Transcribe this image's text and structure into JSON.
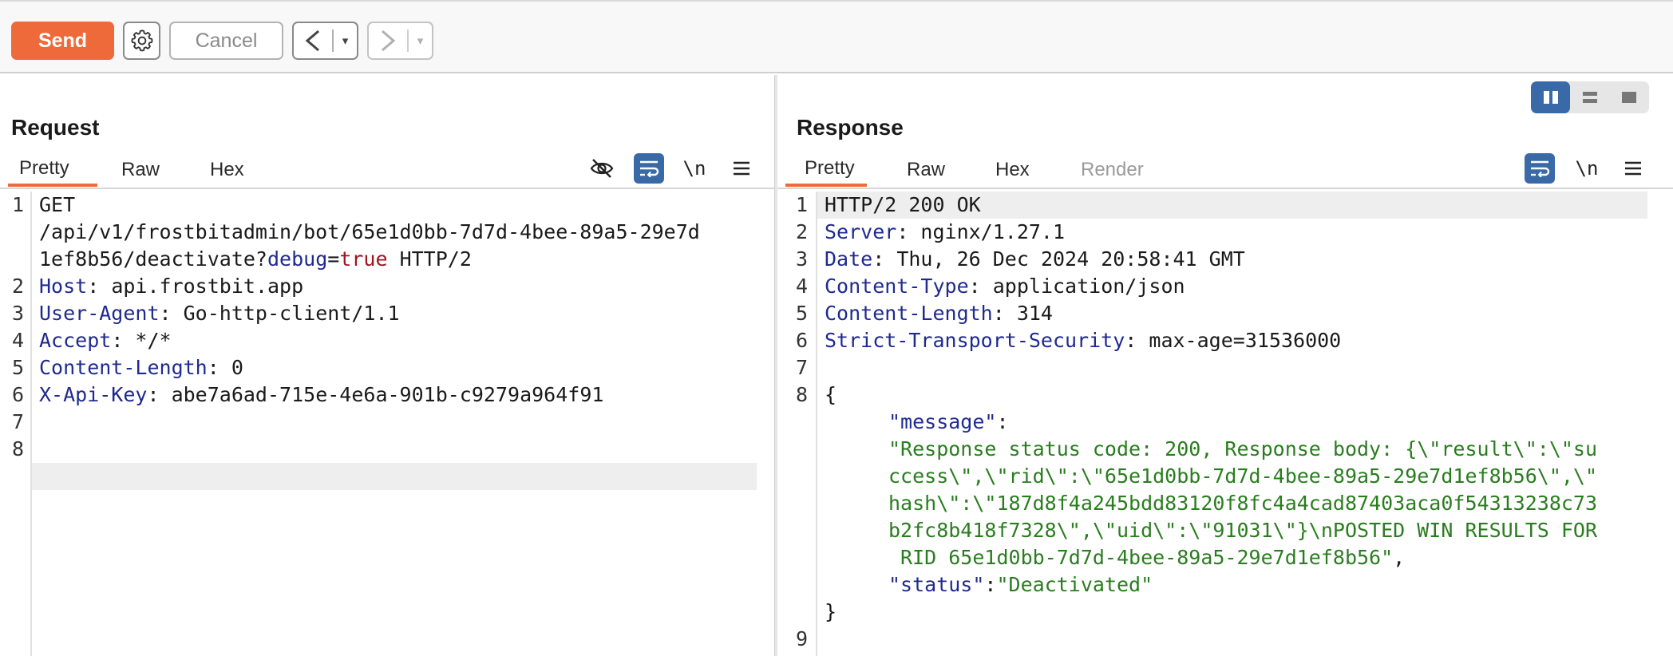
{
  "toolbar": {
    "send_label": "Send",
    "cancel_label": "Cancel",
    "back_glyph": "<",
    "forward_glyph": ">",
    "dropdown_glyph": "▾"
  },
  "request": {
    "title": "Request",
    "tabs": [
      "Pretty",
      "Raw",
      "Hex"
    ],
    "active_tab": "Pretty",
    "newline_toggle": "\\n",
    "line_numbers": [
      "1",
      "2",
      "3",
      "4",
      "5",
      "6",
      "7",
      "8"
    ],
    "line1": {
      "method": "GET",
      "path_a": "/api/v1/frostbitadmin/bot/65e1d0bb-7d7d-4bee-89a5-29e7d",
      "path_b": "1ef8b56/deactivate?",
      "param_key": "debug",
      "equals": "=",
      "param_value": "true",
      "protocol": " HTTP/2"
    },
    "headers": [
      {
        "name": "Host",
        "value": "api.frostbit.app"
      },
      {
        "name": "User-Agent",
        "value": "Go-http-client/1.1"
      },
      {
        "name": "Accept",
        "value": "*/*"
      },
      {
        "name": "Content-Length",
        "value": "0"
      },
      {
        "name": "X-Api-Key",
        "value": "abe7a6ad-715e-4e6a-901b-c9279a964f91"
      }
    ]
  },
  "response": {
    "title": "Response",
    "tabs": [
      "Pretty",
      "Raw",
      "Hex",
      "Render"
    ],
    "active_tab": "Pretty",
    "newline_toggle": "\\n",
    "line_numbers": [
      "1",
      "2",
      "3",
      "4",
      "5",
      "6",
      "7",
      "8",
      "9"
    ],
    "status_line": "HTTP/2 200 OK",
    "headers": [
      {
        "name": "Server",
        "value": "nginx/1.27.1"
      },
      {
        "name": "Date",
        "value": "Thu, 26 Dec 2024 20:58:41 GMT"
      },
      {
        "name": "Content-Type",
        "value": "application/json"
      },
      {
        "name": "Content-Length",
        "value": "314"
      },
      {
        "name": "Strict-Transport-Security",
        "value": "max-age=31536000"
      }
    ],
    "body": {
      "open_brace": "{",
      "message_key": "\"message\"",
      "colon": ":",
      "message_lines": [
        "\"Response status code: 200, Response body: {\\\"result\\\":\\\"su",
        "ccess\\\",\\\"rid\\\":\\\"65e1d0bb-7d7d-4bee-89a5-29e7d1ef8b56\\\",\\\"",
        "hash\\\":\\\"187d8f4a245bdd83120f8fc4a4cad87403aca0f54313238c73",
        "b2fc8b418f7328\\\",\\\"uid\\\":\\\"91031\\\"}\\nPOSTED WIN RESULTS FOR",
        " RID 65e1d0bb-7d7d-4bee-89a5-29e7d1ef8b56\""
      ],
      "comma": ",",
      "status_key": "\"status\"",
      "status_value": "\"Deactivated\"",
      "close_brace": "}"
    }
  }
}
